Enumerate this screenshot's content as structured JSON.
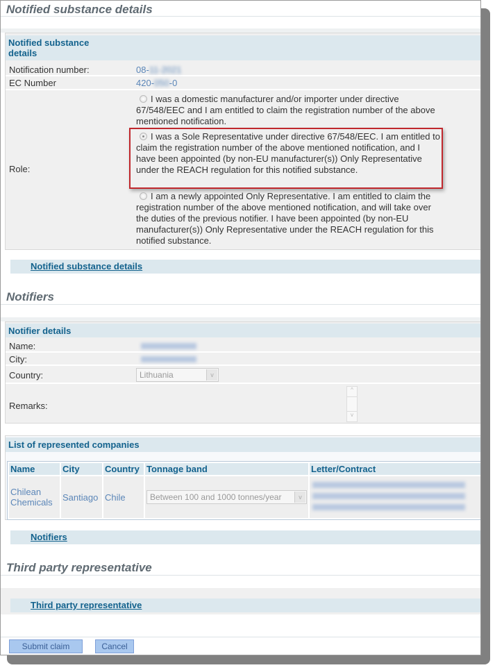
{
  "substance": {
    "section_title": "Notified substance details",
    "panel_title": "Notified substance details",
    "notification_label": "Notification number:",
    "notification_value": "08-11-2021",
    "ec_label": "EC Number",
    "ec_value": "420-050-0",
    "role_label": "Role:",
    "role_options": [
      {
        "text": "I was a domestic manufacturer and/or importer under directive 67/548/EEC and I am entitled to claim the registration number of the above mentioned notification.",
        "selected": false
      },
      {
        "text": "I was a Sole Representative under directive 67/548/EEC. I am entitled to claim the registration number of the above mentioned notification, and I have been appointed (by non-EU manufacturer(s)) Only Representative under the REACH regulation for this notified substance.",
        "selected": true
      },
      {
        "text": "I am a newly appointed Only Representative. I am entitled to claim the registration number of the above mentioned notification, and will take over the duties of the previous notifier. I have been appointed (by non-EU manufacturer(s)) Only Representative under the REACH regulation for this notified substance.",
        "selected": false
      }
    ],
    "link": "Notified substance details",
    "highlight_color": "#c0282d"
  },
  "notifiers": {
    "section_title": "Notifiers",
    "panel_title": "Notifier details",
    "name_label": "Name:",
    "city_label": "City:",
    "country_label": "Country:",
    "country_value": "Lithuania",
    "remarks_label": "Remarks:",
    "companies_title": "List of represented companies",
    "columns": [
      "Name",
      "City",
      "Country",
      "Tonnage band",
      "Letter/Contract"
    ],
    "rows": [
      {
        "name": "Chilean Chemicals",
        "city": "Santiago",
        "country": "Chile",
        "tonnage": "Between 100 and 1000 tonnes/year"
      }
    ],
    "link": "Notifiers"
  },
  "third_party": {
    "section_title": "Third party representative",
    "link": "Third party representative"
  },
  "buttons": {
    "submit": "Submit claim",
    "cancel": "Cancel"
  }
}
